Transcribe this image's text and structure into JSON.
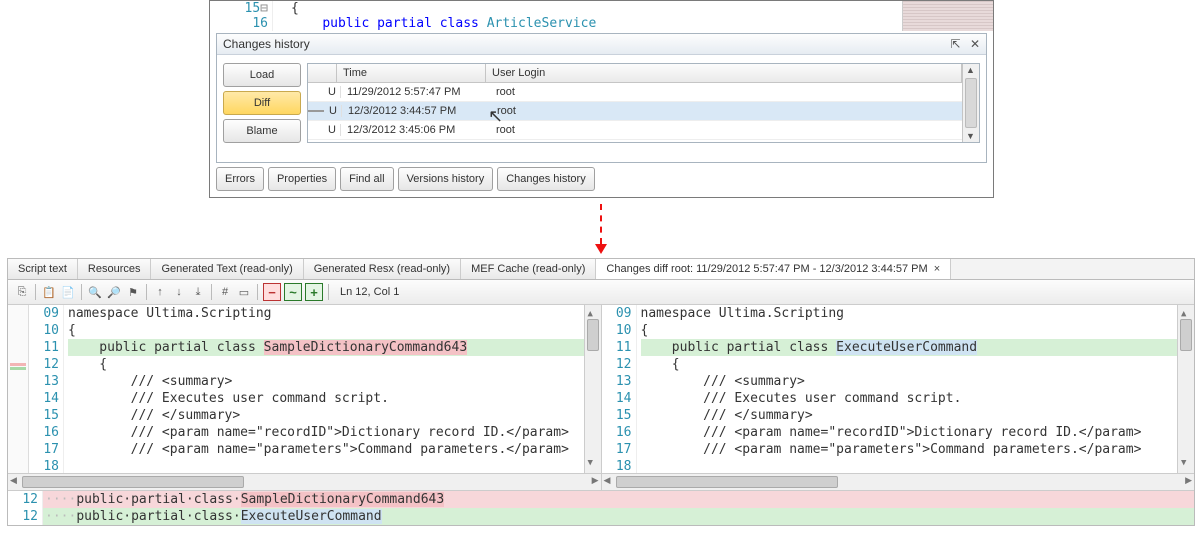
{
  "top": {
    "code": {
      "lines": [
        {
          "n": "15",
          "text": "{"
        },
        {
          "n": "16",
          "kw1": "public",
          "kw2": "partial",
          "kw3": "class",
          "type": "ArticleService"
        }
      ]
    },
    "history": {
      "title": "Changes history",
      "buttons": {
        "load": "Load",
        "diff": "Diff",
        "blame": "Blame"
      },
      "headers": {
        "c0": "",
        "c1": "Time",
        "c2": "User Login"
      },
      "rows": [
        {
          "u": "U",
          "time": "11/29/2012 5:57:47 PM",
          "user": "root"
        },
        {
          "u": "U",
          "time": "12/3/2012 3:44:57 PM",
          "user": "root"
        },
        {
          "u": "U",
          "time": "12/3/2012 3:45:06 PM",
          "user": "root"
        }
      ]
    },
    "bottom_buttons": [
      "Errors",
      "Properties",
      "Find all",
      "Versions history",
      "Changes history"
    ]
  },
  "tabs": [
    "Script text",
    "Resources",
    "Generated Text (read-only)",
    "Generated Resx (read-only)",
    "MEF Cache (read-only)",
    "Changes diff root: 11/29/2012 5:57:47 PM - 12/3/2012 3:44:57 PM"
  ],
  "toolbar": {
    "pos": "Ln 12, Col 1"
  },
  "diff": {
    "left": {
      "lines": [
        {
          "n": "09",
          "t": ""
        },
        {
          "n": "10",
          "t": "namespace Ultima.Scripting"
        },
        {
          "n": "11",
          "t": "{"
        },
        {
          "n": "12",
          "hl": true,
          "pre": "    public partial class ",
          "del": "SampleDictionaryCommand643"
        },
        {
          "n": "13",
          "t": "    {"
        },
        {
          "n": "14",
          "t": "        /// <summary>"
        },
        {
          "n": "15",
          "t": "        /// Executes user command script."
        },
        {
          "n": "16",
          "t": "        /// </summary>"
        },
        {
          "n": "17",
          "t": "        /// <param name=\"recordID\">Dictionary record ID.</param>"
        },
        {
          "n": "18",
          "t": "        /// <param name=\"parameters\">Command parameters.</param>"
        }
      ]
    },
    "right": {
      "lines": [
        {
          "n": "09",
          "t": ""
        },
        {
          "n": "10",
          "t": "namespace Ultima.Scripting"
        },
        {
          "n": "11",
          "t": "{"
        },
        {
          "n": "12",
          "hl": true,
          "pre": "    public partial class ",
          "add": "ExecuteUserCommand"
        },
        {
          "n": "13",
          "t": "    {"
        },
        {
          "n": "14",
          "t": "        /// <summary>"
        },
        {
          "n": "15",
          "t": "        /// Executes user command script."
        },
        {
          "n": "16",
          "t": "        /// </summary>"
        },
        {
          "n": "17",
          "t": "        /// <param name=\"recordID\">Dictionary record ID.</param>"
        },
        {
          "n": "18",
          "t": "        /// <param name=\"parameters\">Command parameters.</param>"
        }
      ]
    }
  },
  "merged": {
    "rows": [
      {
        "n": "12",
        "dots": "····",
        "pre": "public·partial·class·",
        "old": "SampleDictionaryCommand643",
        "bg": "del"
      },
      {
        "n": "12",
        "dots": "····",
        "pre": "public·partial·class·",
        "new": "ExecuteUserCommand",
        "bg": "add"
      }
    ]
  }
}
